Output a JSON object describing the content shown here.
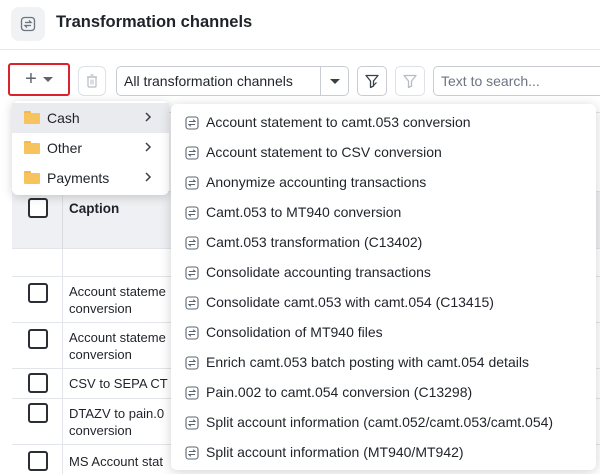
{
  "header": {
    "title": "Transformation channels",
    "icon": "transform-icon"
  },
  "toolbar": {
    "add_icon": "+",
    "channel_filter_value": "All transformation channels",
    "search_placeholder": "Text to search..."
  },
  "table": {
    "columns": [
      "Caption"
    ],
    "rows": [
      {
        "caption": "Account stateme conversion",
        "lines": [
          "Account stateme",
          "conversion"
        ]
      },
      {
        "caption": "Account stateme conversion",
        "lines": [
          "Account stateme",
          "conversion"
        ]
      },
      {
        "caption": "CSV to SEPA CT",
        "lines": [
          "CSV to SEPA CT"
        ]
      },
      {
        "caption": "DTAZV to pain.0 conversion",
        "lines": [
          "DTAZV to pain.0",
          "conversion"
        ]
      },
      {
        "caption": "MS Account stat",
        "lines": [
          "MS Account stat"
        ]
      }
    ]
  },
  "folder_menu": {
    "items": [
      {
        "label": "Cash",
        "active": true
      },
      {
        "label": "Other",
        "active": false
      },
      {
        "label": "Payments",
        "active": false
      }
    ]
  },
  "sub_menu": {
    "items": [
      "Account statement to camt.053 conversion",
      "Account statement to CSV conversion",
      "Anonymize accounting transactions",
      "Camt.053 to MT940 conversion",
      "Camt.053 transformation (C13402)",
      "Consolidate accounting transactions",
      "Consolidate camt.053 with camt.054 (C13415)",
      "Consolidation of MT940 files",
      "Enrich camt.053 batch posting with camt.054 details",
      "Pain.002 to camt.054 conversion (C13298)",
      "Split account information (camt.052/camt.053/camt.054)",
      "Split account information (MT940/MT942)"
    ]
  },
  "colors": {
    "accent_border": "#d9242b",
    "folder": "#f7c35f",
    "icon": "#5c6570"
  }
}
